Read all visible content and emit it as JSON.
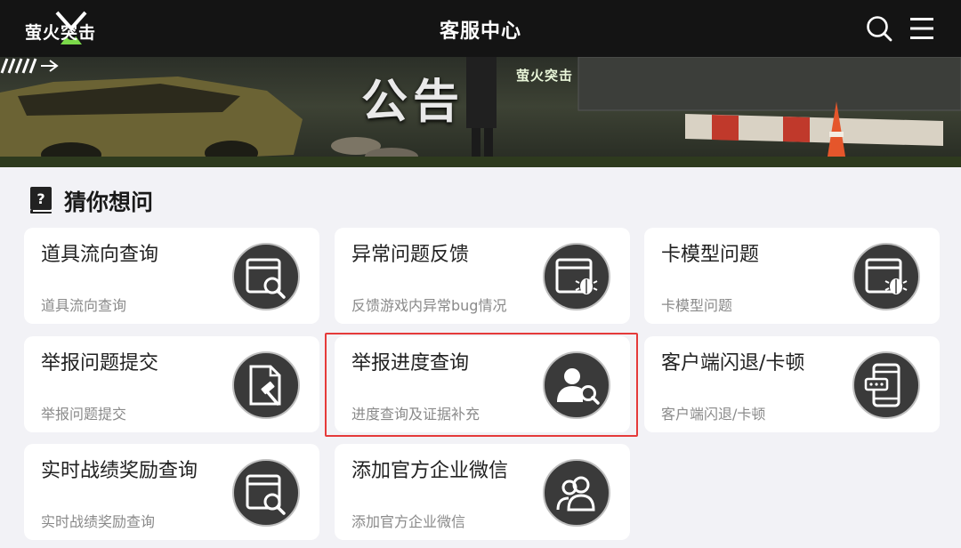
{
  "header": {
    "logo_text": "萤火突击",
    "title": "客服中心",
    "search_icon": "search-icon",
    "menu_icon": "menu-icon"
  },
  "banner": {
    "title": "公告",
    "brand": "萤火突击"
  },
  "section": {
    "title": "猜你想问",
    "icon": "question-book-icon"
  },
  "cards": [
    {
      "title": "道具流向查询",
      "desc": "道具流向查询",
      "icon": "window-search-icon"
    },
    {
      "title": "异常问题反馈",
      "desc": "反馈游戏内异常bug情况",
      "icon": "window-bug-icon"
    },
    {
      "title": "卡模型问题",
      "desc": "卡模型问题",
      "icon": "window-bug-icon"
    },
    {
      "title": "举报问题提交",
      "desc": "举报问题提交",
      "icon": "document-gavel-icon"
    },
    {
      "title": "举报进度查询",
      "desc": "进度查询及证据补充",
      "icon": "user-search-icon"
    },
    {
      "title": "客户端闪退/卡顿",
      "desc": "客户端闪退/卡顿",
      "icon": "phone-icon"
    },
    {
      "title": "实时战绩奖励查询",
      "desc": "实时战绩奖励查询",
      "icon": "window-search-icon"
    },
    {
      "title": "添加官方企业微信",
      "desc": "添加官方企业微信",
      "icon": "users-icon"
    }
  ],
  "colors": {
    "topbar": "#141414",
    "page_bg": "#f2f2f6",
    "icon_circle": "#3a3a3a",
    "highlight": "#e53a3a"
  }
}
